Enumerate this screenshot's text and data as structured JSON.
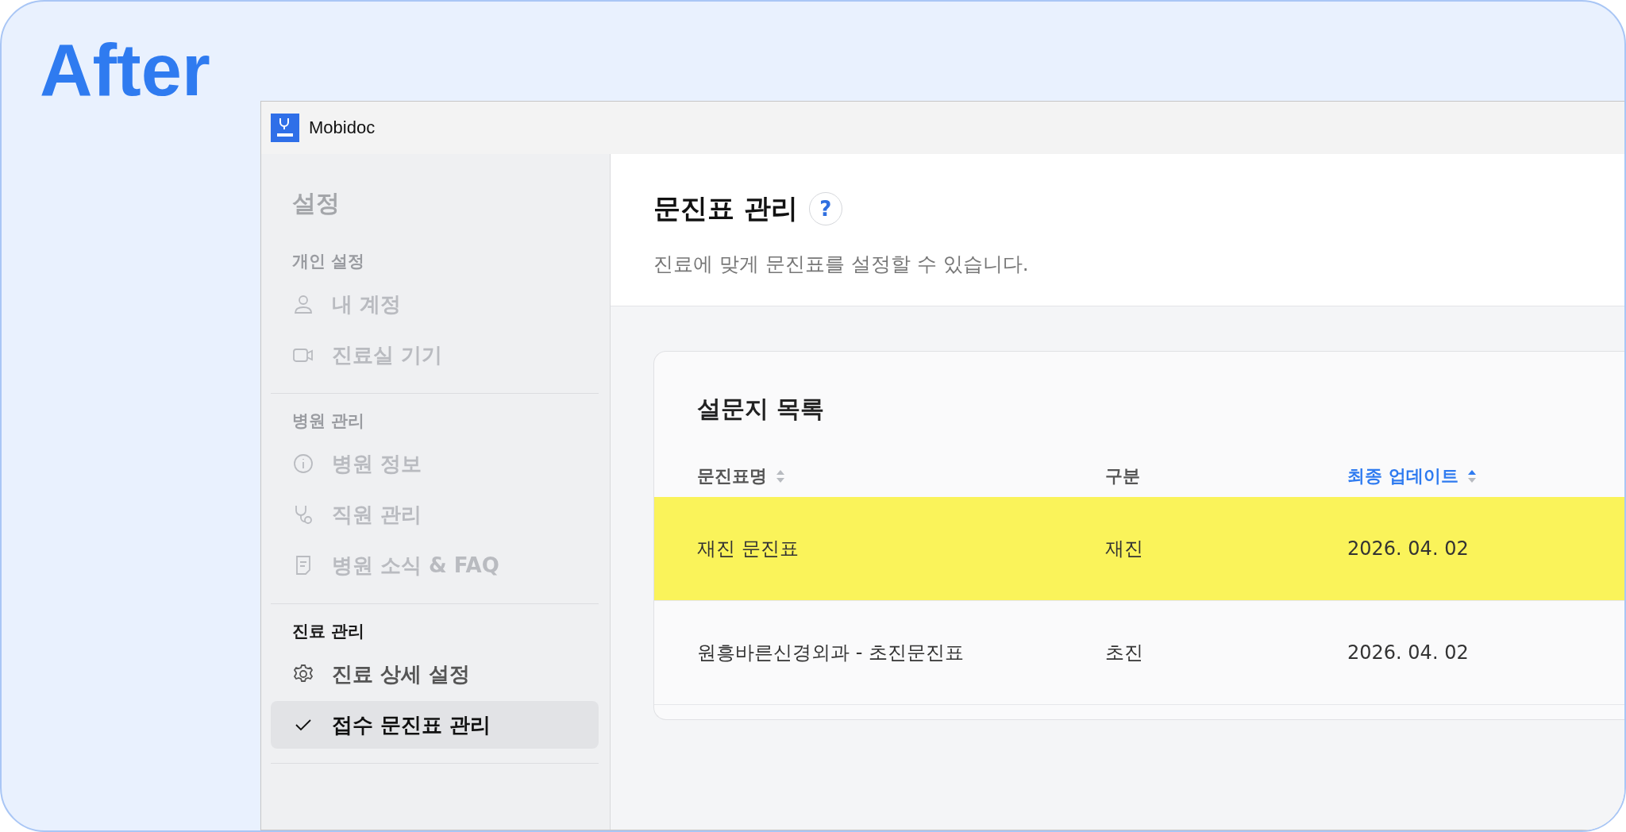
{
  "caption": "After",
  "window": {
    "title": "Mobidoc"
  },
  "sidebar": {
    "title": "설정",
    "sections": [
      {
        "label": "개인 설정",
        "disabled": true,
        "items": [
          {
            "label": "내 계정",
            "disabled": true,
            "selected": false
          },
          {
            "label": "진료실 기기",
            "disabled": true,
            "selected": false
          }
        ]
      },
      {
        "label": "병원 관리",
        "disabled": true,
        "items": [
          {
            "label": "병원 정보",
            "disabled": true,
            "selected": false
          },
          {
            "label": "직원 관리",
            "disabled": true,
            "selected": false
          },
          {
            "label": "병원 소식 & FAQ",
            "disabled": true,
            "selected": false
          }
        ]
      },
      {
        "label": "진료 관리",
        "disabled": false,
        "items": [
          {
            "label": "진료 상세 설정",
            "disabled": false,
            "selected": false
          },
          {
            "label": "접수 문진표 관리",
            "disabled": false,
            "selected": true
          }
        ]
      }
    ]
  },
  "page": {
    "title": "문진표 관리",
    "help": "?",
    "description": "진료에 맞게 문진표를 설정할 수 있습니다."
  },
  "card": {
    "title": "설문지 목록",
    "columns": [
      {
        "label": "문진표명",
        "sortable": true,
        "active": false
      },
      {
        "label": "구분",
        "sortable": false,
        "active": false
      },
      {
        "label": "최종 업데이트",
        "sortable": true,
        "active": true
      }
    ],
    "rows": [
      {
        "cells": [
          "재진 문진표",
          "재진",
          "2026. 04. 02"
        ],
        "highlighted": true
      },
      {
        "cells": [
          "원흥바른신경외과 - 초진문진표",
          "초진",
          "2026. 04. 02"
        ],
        "highlighted": false
      }
    ]
  }
}
